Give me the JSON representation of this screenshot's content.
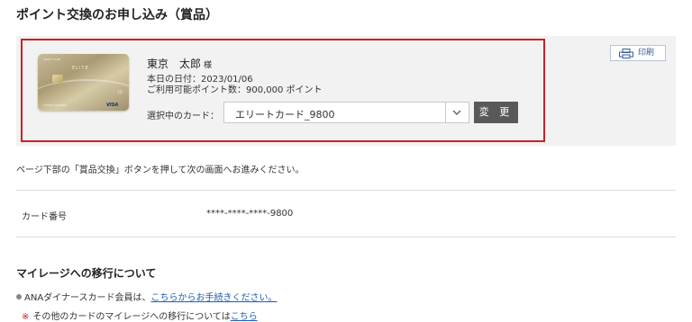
{
  "page": {
    "title": "ポイント交換のお申し込み（賞品）"
  },
  "card_panel": {
    "card_image": {
      "brand_text": "ELITE",
      "top_text": "TRUST CLUB",
      "holder_text": "SAMPLE MEMBER",
      "network_text": "VISA"
    },
    "holder_name": "東京　太郎",
    "honorific": "様",
    "date_line": "本日の日付：2023/01/06",
    "points_line": "ご利用可能ポイント数：900,000 ポイント",
    "select_label": "選択中のカード：",
    "selected_card": "エリートカード_9800",
    "change_button": "変 更"
  },
  "print_button": {
    "label": "印刷",
    "icon": "printer-icon"
  },
  "instruction": "ページ下部の「賞品交換」ボタンを押して次の画面へお進みください。",
  "card_number": {
    "label": "カード番号",
    "value": "****-****-****-9800"
  },
  "mileage": {
    "title": "マイレージへの移行について",
    "bullet_prefix": "ANAダイナースカード会員は、",
    "bullet_link": "こちらからお手続きください。",
    "note_mark": "※",
    "note_text": "その他のカードのマイレージへの移行については",
    "note_link": "こちら"
  },
  "colors": {
    "highlight_frame": "#cc1f26",
    "link": "#1a5fb4",
    "button_dark": "#595959"
  }
}
